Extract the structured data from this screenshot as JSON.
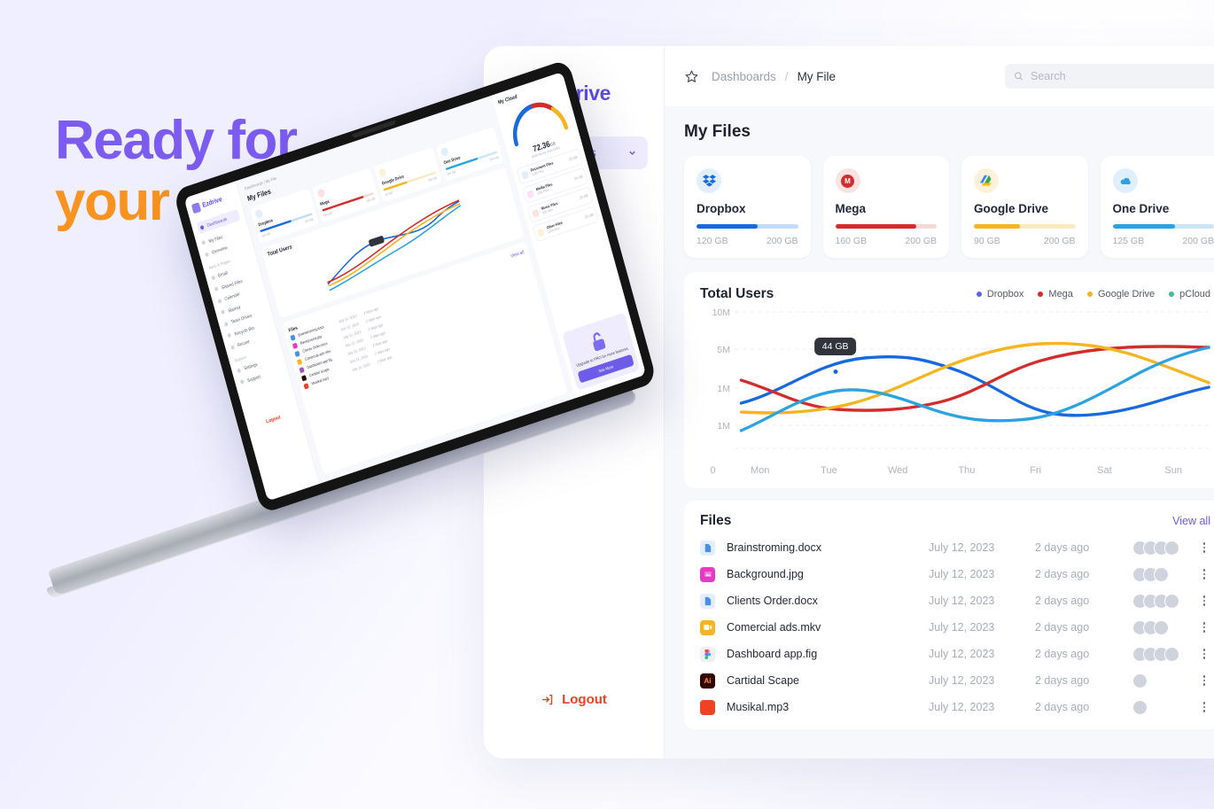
{
  "hero": {
    "line1": "Ready for",
    "line2": "your project"
  },
  "brand": {
    "name": "Ezdrive",
    "logo_icon": "ezdrive-logo-icon"
  },
  "sidebar": {
    "main_item": {
      "label": "Dashboards",
      "icon": "home-icon",
      "chevron": "chevron-down-icon"
    },
    "sub_items": [
      {
        "label": "My Files",
        "active": true
      },
      {
        "label": "Overview",
        "active": false
      }
    ],
    "section_label": "Apps & Pages",
    "logout": {
      "label": "Logout",
      "icon": "logout-icon",
      "color": "#ef4123"
    }
  },
  "topbar": {
    "star_icon": "star-icon",
    "breadcrumb_root": "Dashboards",
    "breadcrumb_sep": "/",
    "breadcrumb_current": "My File",
    "search": {
      "placeholder": "Search",
      "value": "",
      "icon": "search-icon"
    }
  },
  "main": {
    "title": "My Files",
    "storage_cards": [
      {
        "name": "Dropbox",
        "used": "120 GB",
        "total": "200 GB",
        "percent": 60,
        "color": "#1769e0",
        "track": "#c3dcfb",
        "icon": "dropbox-icon",
        "icon_bg": "#e3eefd"
      },
      {
        "name": "Mega",
        "used": "160 GB",
        "total": "200 GB",
        "percent": 80,
        "color": "#d32c2c",
        "track": "#f9d7d7",
        "icon": "mega-icon",
        "icon_bg": "#fbe2e2"
      },
      {
        "name": "Google Drive",
        "used": "90 GB",
        "total": "200 GB",
        "percent": 45,
        "color": "#f5b520",
        "track": "#fbe9bf",
        "icon": "google-drive-icon",
        "icon_bg": "#fdf2d9"
      },
      {
        "name": "One Drive",
        "used": "125 GB",
        "total": "200 GB",
        "percent": 62,
        "color": "#2aa3e0",
        "track": "#c9e7f8",
        "icon": "one-drive-icon",
        "icon_bg": "#dff0fb"
      }
    ],
    "files_section": {
      "title": "Files",
      "view_all": "View all",
      "rows": [
        {
          "name": "Brainstroming.docx",
          "date": "July 12, 2023",
          "ago": "2 days ago",
          "avatars": 4,
          "icon": "doc-file-icon",
          "icon_color": "#4a90e2",
          "icon_bg": "#e3eefd"
        },
        {
          "name": "Background.jpg",
          "date": "July 12, 2023",
          "ago": "2 days ago",
          "avatars": 3,
          "icon": "image-file-icon",
          "icon_color": "#ffffff",
          "icon_bg": "#e838c6"
        },
        {
          "name": "Clients Order.docx",
          "date": "July 12, 2023",
          "ago": "2 days ago",
          "avatars": 4,
          "icon": "doc-file-icon",
          "icon_color": "#4a90e2",
          "icon_bg": "#e3eefd"
        },
        {
          "name": "Comercial ads.mkv",
          "date": "July 12, 2023",
          "ago": "2 days ago",
          "avatars": 3,
          "icon": "video-file-icon",
          "icon_color": "#ffffff",
          "icon_bg": "#f5b520"
        },
        {
          "name": "Dashboard app.fig",
          "date": "July 12, 2023",
          "ago": "2 days ago",
          "avatars": 4,
          "icon": "figma-file-icon",
          "icon_color": "#ffffff",
          "icon_bg": "#eef0f4"
        },
        {
          "name": "Cartidal Scape",
          "date": "July 12, 2023",
          "ago": "2 days ago",
          "avatars": 1,
          "icon": "illustrator-file-icon",
          "icon_color": "#ff9a00",
          "icon_bg": "#330000"
        },
        {
          "name": "Musikal.mp3",
          "date": "July 12, 2023",
          "ago": "2 days ago",
          "avatars": 1,
          "icon": "audio-file-icon",
          "icon_color": "#ffffff",
          "icon_bg": "#ef4123"
        }
      ],
      "row_menu_icon": "kebab-menu-icon"
    }
  },
  "chart_data": {
    "type": "line",
    "title": "Total Users",
    "xlabel": "",
    "ylabel": "",
    "x": [
      "0",
      "Mon",
      "Tue",
      "Wed",
      "Thu",
      "Fri",
      "Sat",
      "Sun"
    ],
    "categories": [
      "0",
      "Mon",
      "Tue",
      "Wed",
      "Thu",
      "Fri",
      "Sat",
      "Sun"
    ],
    "ytick_labels": [
      "10M",
      "5M",
      "1M",
      "1M",
      "0"
    ],
    "ylim": [
      0,
      10
    ],
    "grid": true,
    "legend_position": "top-right",
    "tooltip": {
      "label": "44 GB",
      "x_category": "Wed",
      "series": "Dropbox"
    },
    "series": [
      {
        "name": "Dropbox",
        "color": "#1769e0",
        "values": [
          2.0,
          2.4,
          3.6,
          3.8,
          3.0,
          2.1,
          1.7,
          2.3
        ]
      },
      {
        "name": "Mega",
        "color": "#d32c2c",
        "values": [
          2.9,
          2.2,
          1.9,
          1.9,
          2.4,
          3.3,
          3.9,
          4.0
        ]
      },
      {
        "name": "Google Drive",
        "color": "#f5b520",
        "values": [
          1.8,
          1.8,
          2.0,
          2.7,
          3.5,
          3.9,
          3.9,
          3.1
        ]
      },
      {
        "name": "pCloud",
        "color": "#2aa3e0",
        "values": [
          1.1,
          2.0,
          2.7,
          2.3,
          1.7,
          1.6,
          2.3,
          3.6
        ]
      }
    ]
  },
  "laptop": {
    "section_label": "Apps & Pages",
    "brand": "Ezdrive",
    "nav": [
      "Dashboards",
      "My Files",
      "Overview",
      "Email",
      "Shared Files",
      "Calender",
      "Starred",
      "Team Drives",
      "Recycle Bin",
      "Recent",
      "Settings",
      "Support"
    ],
    "nav_group_2": "Apps & Pages",
    "nav_group_3": "Support",
    "logout": "Logout",
    "title": "My Files",
    "breadcrumb": "Dashboards / My File",
    "chart_title": "Total Users",
    "tooltip": "44 GB",
    "view_all": "View all",
    "files_title": "Files",
    "cards": [
      {
        "name": "Dropbox",
        "used": "120 GB",
        "total": "200 GB",
        "percent": 60,
        "color": "#1769e0",
        "track": "#c3dcfb",
        "icon_bg": "#e3eefd"
      },
      {
        "name": "Mega",
        "used": "160 GB",
        "total": "200 GB",
        "percent": 80,
        "color": "#d32c2c",
        "track": "#f9d7d7",
        "icon_bg": "#fbe2e2"
      },
      {
        "name": "Google Drive",
        "used": "90 GB",
        "total": "200 GB",
        "percent": 45,
        "color": "#f5b520",
        "track": "#fbe9bf",
        "icon_bg": "#fdf2d9"
      },
      {
        "name": "One Drive",
        "used": "125 GB",
        "total": "200 GB",
        "percent": 62,
        "color": "#2aa3e0",
        "track": "#c9e7f8",
        "icon_bg": "#dff0fb"
      }
    ],
    "cloud_panel": {
      "title": "My Cloud",
      "value": "72.36",
      "unit": "GB",
      "subtitle": "Used for my drive folder",
      "items": [
        {
          "label": "Document Files",
          "sub": "1235 Files",
          "size": "20 GB",
          "color": "#4a90e2",
          "bg": "#e3eefd"
        },
        {
          "label": "Media Files",
          "sub": "1025 Files",
          "size": "24 GB",
          "color": "#e838c6",
          "bg": "#fce2f6"
        },
        {
          "label": "Music Files",
          "sub": "520 Files",
          "size": "20 GB",
          "color": "#ef4123",
          "bg": "#fde3de"
        },
        {
          "label": "Other Files",
          "sub": "1205 Files",
          "size": "25 GB",
          "color": "#f5b520",
          "bg": "#fdf2d9"
        }
      ]
    },
    "promo": {
      "text": "Upgrade to PRO for more features.",
      "button": "See More"
    },
    "files": [
      {
        "name": "Brainstroming.docx",
        "date": "July 12, 2023",
        "ago": "2 days ago",
        "color": "#4a90e2"
      },
      {
        "name": "Background.jpg",
        "date": "July 12, 2023",
        "ago": "2 days ago",
        "color": "#e838c6"
      },
      {
        "name": "Clients Order.docx",
        "date": "July 12, 2023",
        "ago": "2 days ago",
        "color": "#4a90e2"
      },
      {
        "name": "Comercial ads.mkv",
        "date": "July 12, 2023",
        "ago": "2 days ago",
        "color": "#f5b520"
      },
      {
        "name": "Dashboard app.fig",
        "date": "July 12, 2023",
        "ago": "2 days ago",
        "color": "#9b59b6"
      },
      {
        "name": "Cartidal Scape",
        "date": "July 12, 2023",
        "ago": "2 days ago",
        "color": "#330000"
      },
      {
        "name": "Musikal.mp3",
        "date": "July 12, 2023",
        "ago": "2 days ago",
        "color": "#ef4123"
      }
    ]
  },
  "colors": {
    "background": "#efefff",
    "accent_purple": "#6c5ce7",
    "accent_orange": "#f7931e",
    "logout_red": "#ef4123"
  }
}
